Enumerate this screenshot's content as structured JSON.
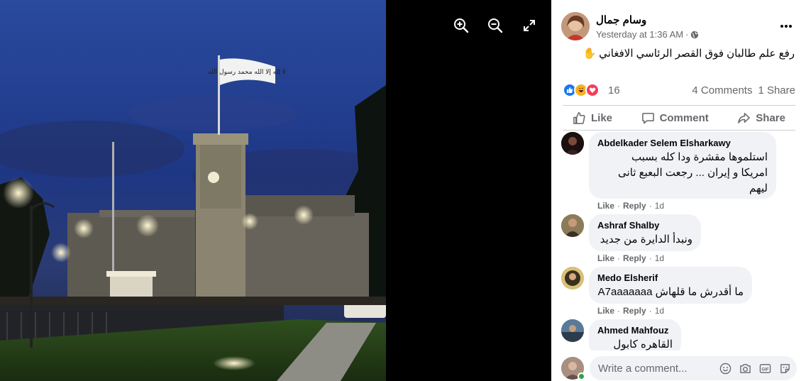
{
  "viewer": {
    "zoom_in": "zoom-in",
    "zoom_out": "zoom-out",
    "fullscreen": "fullscreen"
  },
  "post": {
    "author": "وسام جمال",
    "time": "Yesterday at 1:36 AM",
    "separator": "·",
    "text": "رفع علم طالبان فوق القصر الرئاسي الافغاني",
    "text_emoji": "✋",
    "reaction_count": "16",
    "comments_count": "4 Comments",
    "shares_count": "1 Share",
    "flag_text": "لا إله إلا الله محمد رسول الله"
  },
  "actions": {
    "like": "Like",
    "comment": "Comment",
    "share": "Share"
  },
  "comments": [
    {
      "name": "Abdelkader Selem Elsharkawy",
      "lines": [
        "استلموها مقشرة ودا كله بسبب",
        "امريكا و إيران ... رجعت البعبع ثانى",
        "ليهم"
      ],
      "like": "Like",
      "reply": "Reply",
      "time": "1d"
    },
    {
      "name": "Ashraf Shalby",
      "lines": [
        "ونبدأ الدايرة من جديد"
      ],
      "like": "Like",
      "reply": "Reply",
      "time": "1d"
    },
    {
      "name": "Medo Elsherif",
      "lines": [
        "ما أقدرش ما قلهاش A7aaaaaaa"
      ],
      "like": "Like",
      "reply": "Reply",
      "time": "1d"
    },
    {
      "name": "Ahmed Mahfouz",
      "lines": [
        "القاهره كابول"
      ]
    }
  ],
  "write": {
    "placeholder": "Write a comment..."
  },
  "colors": {
    "like_blue": "#1877f2",
    "love_red": "#f33e58",
    "haha_yellow": "#f7b125",
    "muted": "#65676b",
    "bubble": "#f0f2f5"
  }
}
